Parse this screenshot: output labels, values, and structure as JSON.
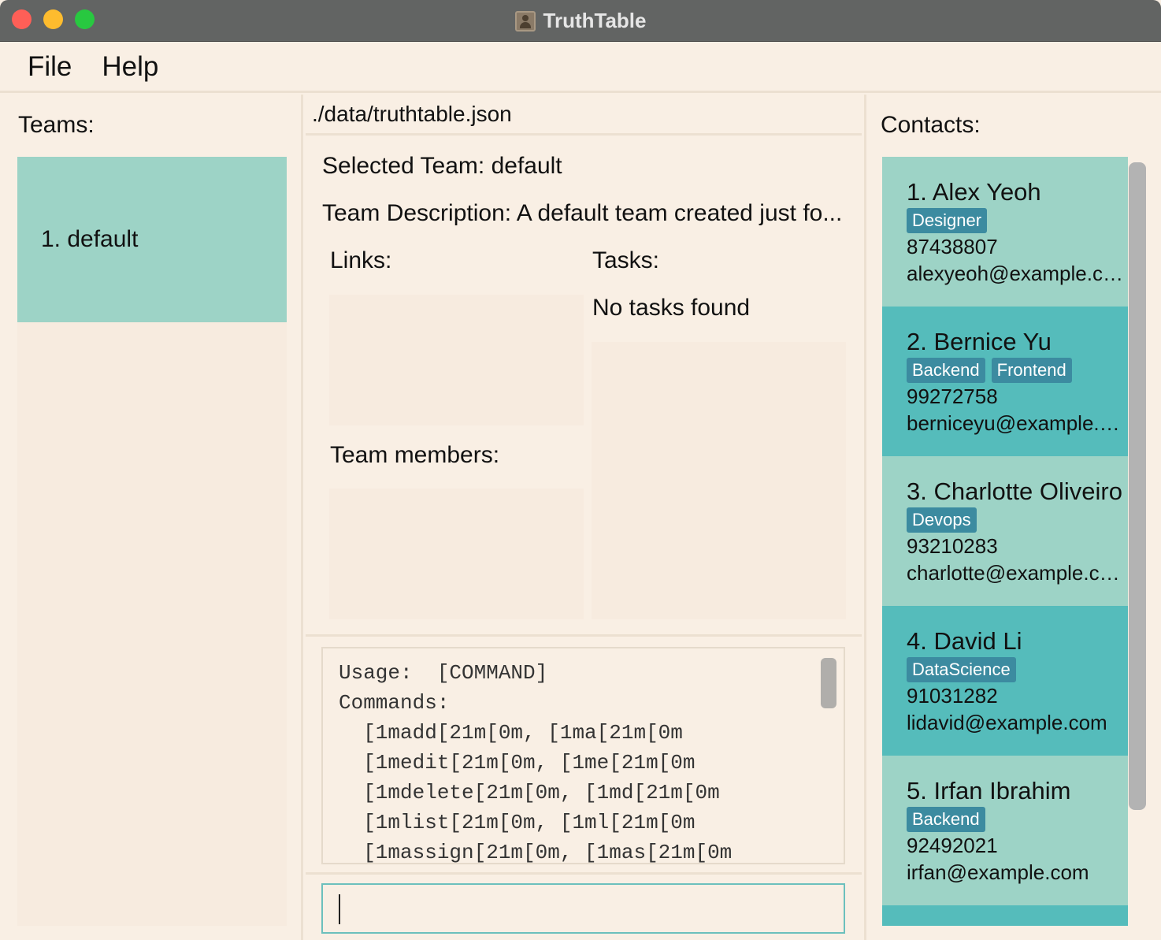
{
  "window": {
    "title": "TruthTable"
  },
  "menu": [
    {
      "label": "File"
    },
    {
      "label": "Help"
    }
  ],
  "teams": {
    "heading": "Teams:",
    "items": [
      {
        "label": "1. default"
      }
    ]
  },
  "main": {
    "file_path": "./data/truthtable.json",
    "selected_team": "Selected Team: default",
    "team_description": "Team Description: A default team created just fo...",
    "links_heading": "Links:",
    "tasks_heading": "Tasks:",
    "tasks_empty": "No tasks found",
    "members_heading": "Team members:"
  },
  "result_display": {
    "text": "Usage:  [COMMAND]\nCommands:\n  [1madd[21m[0m, [1ma[21m[0m\n  [1medit[21m[0m, [1me[21m[0m\n  [1mdelete[21m[0m, [1md[21m[0m\n  [1mlist[21m[0m, [1ml[21m[0m\n  [1massign[21m[0m, [1mas[21m[0m"
  },
  "command_box": {
    "value": ""
  },
  "contacts": {
    "heading": "Contacts:",
    "items": [
      {
        "name": "1. Alex Yeoh",
        "tags": [
          "Designer"
        ],
        "phone": "87438807",
        "email": "alexyeoh@example.com"
      },
      {
        "name": "2. Bernice Yu",
        "tags": [
          "Backend",
          "Frontend"
        ],
        "phone": "99272758",
        "email": "berniceyu@example.c..."
      },
      {
        "name": "3. Charlotte Oliveiro",
        "tags": [
          "Devops"
        ],
        "phone": "93210283",
        "email": "charlotte@example.com"
      },
      {
        "name": "4. David Li",
        "tags": [
          "DataScience"
        ],
        "phone": "91031282",
        "email": "lidavid@example.com"
      },
      {
        "name": "5. Irfan Ibrahim",
        "tags": [
          "Backend"
        ],
        "phone": "92492021",
        "email": "irfan@example.com"
      }
    ]
  }
}
